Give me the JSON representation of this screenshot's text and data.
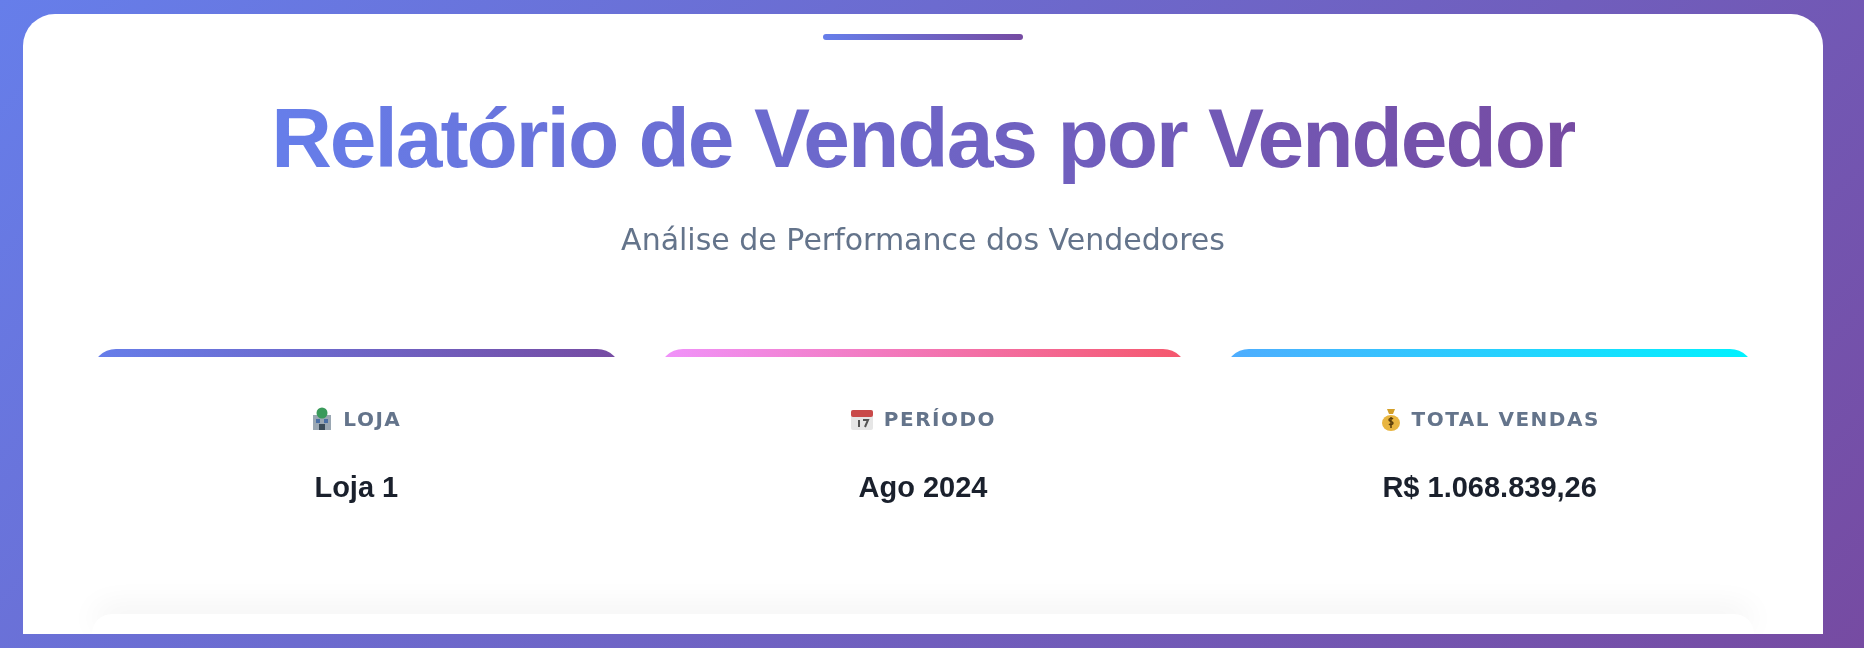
{
  "header": {
    "title": "Relatório de Vendas por Vendedor",
    "subtitle": "Análise de Performance dos Vendedores"
  },
  "cards": [
    {
      "kind": "store",
      "label": "LOJA",
      "value": "Loja 1"
    },
    {
      "kind": "calendar",
      "label": "PERÍODO",
      "value": "Ago 2024"
    },
    {
      "kind": "money",
      "label": "TOTAL VENDAS",
      "value": "R$ 1.068.839,26"
    }
  ]
}
